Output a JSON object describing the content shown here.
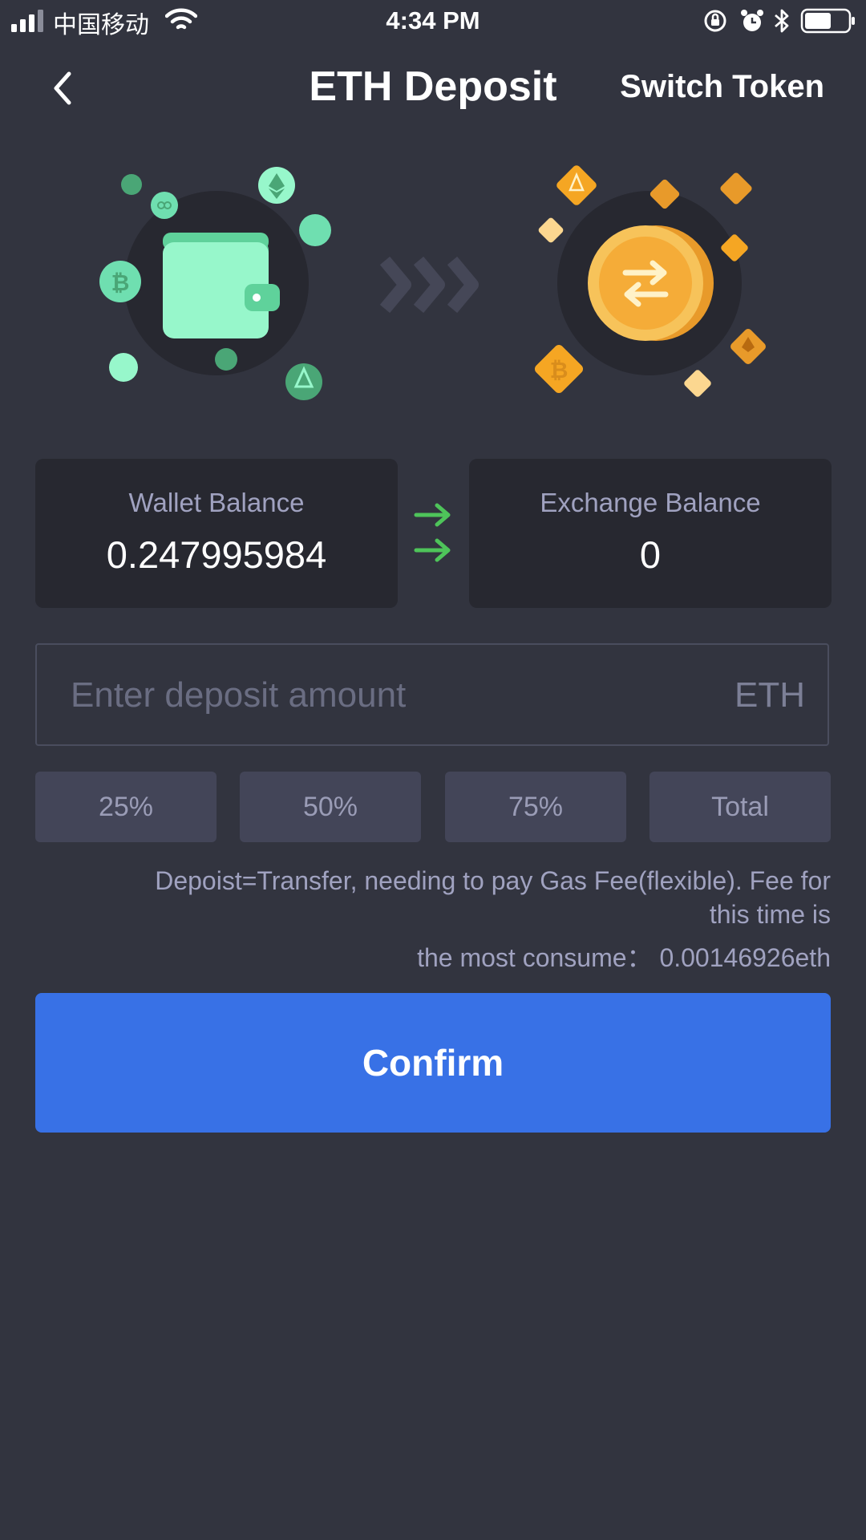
{
  "status_bar": {
    "carrier": "中国移动",
    "time": "4:34 PM"
  },
  "nav": {
    "title": "ETH Deposit",
    "switch_token": "Switch Token"
  },
  "wallet_card": {
    "label": "Wallet Balance",
    "value": "0.247995984"
  },
  "exchange_card": {
    "label": "Exchange Balance",
    "value": "0"
  },
  "deposit": {
    "placeholder": "Enter deposit amount",
    "value": "",
    "unit": "ETH"
  },
  "percent_buttons": [
    "25%",
    "50%",
    "75%",
    "Total"
  ],
  "fee": {
    "line1": "Depoist=Transfer, needing to pay Gas Fee(flexible). Fee for",
    "line2": "this time is",
    "line3": "the most consume： 0.00146926eth"
  },
  "confirm_label": "Confirm",
  "colors": {
    "background": "#32343f",
    "card": "#272830",
    "accent_blue": "#3871e6",
    "wallet_green": "#97f7cb",
    "exchange_orange": "#f5a623",
    "arrow_green": "#4ec45a"
  }
}
